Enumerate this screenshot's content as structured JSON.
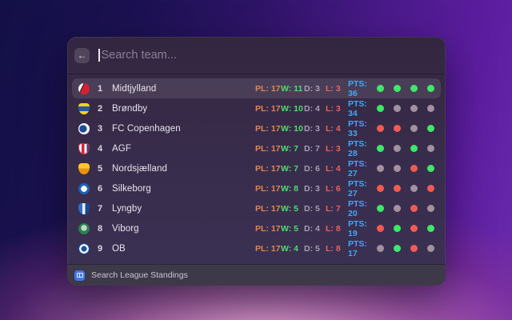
{
  "window": {
    "search": {
      "value": "",
      "placeholder": "Search team..."
    },
    "back_icon": "←",
    "selected_index": 0,
    "teams": [
      {
        "rank": "1",
        "name": "Midtjylland",
        "badge": "fcm",
        "badge_shape": "circle",
        "badge_colors": [
          "#d6202f",
          "#f4f2f2",
          "#2a2530"
        ],
        "pl": "PL: 17",
        "w": "W: 11",
        "d": "D: 3",
        "l": "L: 3",
        "pts": "PTS: 36",
        "form": [
          "win",
          "win",
          "win",
          "win"
        ]
      },
      {
        "rank": "2",
        "name": "Brøndby",
        "badge": "brondby",
        "badge_shape": "shield",
        "badge_colors": [
          "#ffd21e",
          "#2559a8"
        ],
        "pl": "PL: 17",
        "w": "W: 10",
        "d": "D: 4",
        "l": "L: 3",
        "pts": "PTS: 34",
        "form": [
          "win",
          "draw",
          "draw",
          "draw"
        ]
      },
      {
        "rank": "3",
        "name": "FC Copenhagen",
        "badge": "fck",
        "badge_shape": "circle",
        "badge_colors": [
          "#1b4c9b",
          "#f2f3f5"
        ],
        "pl": "PL: 17",
        "w": "W: 10",
        "d": "D: 3",
        "l": "L: 4",
        "pts": "PTS: 33",
        "form": [
          "loss",
          "loss",
          "draw",
          "win"
        ]
      },
      {
        "rank": "4",
        "name": "AGF",
        "badge": "agf",
        "badge_shape": "shield",
        "badge_colors": [
          "#f5f4f4",
          "#d8243a",
          "#27418c"
        ],
        "pl": "PL: 17",
        "w": "W: 7",
        "d": "D: 7",
        "l": "L: 3",
        "pts": "PTS: 28",
        "form": [
          "win",
          "draw",
          "win",
          "draw"
        ]
      },
      {
        "rank": "5",
        "name": "Nordsjælland",
        "badge": "fcn",
        "badge_shape": "shield",
        "badge_colors": [
          "#ffc62e",
          "#e8920e"
        ],
        "pl": "PL: 17",
        "w": "W: 7",
        "d": "D: 6",
        "l": "L: 4",
        "pts": "PTS: 27",
        "form": [
          "draw",
          "draw",
          "loss",
          "win"
        ]
      },
      {
        "rank": "6",
        "name": "Silkeborg",
        "badge": "silkeborg",
        "badge_shape": "circle",
        "badge_colors": [
          "#2160b4",
          "#f4f6f8"
        ],
        "pl": "PL: 17",
        "w": "W: 8",
        "d": "D: 3",
        "l": "L: 6",
        "pts": "PTS: 27",
        "form": [
          "loss",
          "loss",
          "draw",
          "loss"
        ]
      },
      {
        "rank": "7",
        "name": "Lyngby",
        "badge": "lyngby",
        "badge_shape": "shield",
        "badge_colors": [
          "#2f6ec6",
          "#e8edf5",
          "#174a92"
        ],
        "pl": "PL: 17",
        "w": "W: 5",
        "d": "D: 5",
        "l": "L: 7",
        "pts": "PTS: 20",
        "form": [
          "win",
          "draw",
          "loss",
          "draw"
        ]
      },
      {
        "rank": "8",
        "name": "Viborg",
        "badge": "viborg",
        "badge_shape": "circle",
        "badge_colors": [
          "#2c7d52",
          "#bcd9c2"
        ],
        "pl": "PL: 17",
        "w": "W: 5",
        "d": "D: 4",
        "l": "L: 8",
        "pts": "PTS: 19",
        "form": [
          "loss",
          "win",
          "loss",
          "win"
        ]
      },
      {
        "rank": "9",
        "name": "OB",
        "badge": "ob",
        "badge_shape": "circle",
        "badge_colors": [
          "#1b4f9e",
          "#f2f4f6"
        ],
        "pl": "PL: 17",
        "w": "W: 4",
        "d": "D: 5",
        "l": "L: 8",
        "pts": "PTS: 17",
        "form": [
          "draw",
          "win",
          "loss",
          "draw"
        ]
      }
    ],
    "footer": {
      "label": "Search League Standings",
      "icon": "table-grid-icon"
    }
  },
  "colors": {
    "form_win": "#3ee868",
    "form_draw": "#a3919f",
    "form_loss": "#f25b52",
    "stat_pl": "#e5854f",
    "stat_w": "#4fdc6b",
    "stat_d": "#a79db4",
    "stat_l": "#ef6157",
    "stat_pts": "#41a7f5",
    "footer_icon_bg": "#3f76e8"
  }
}
